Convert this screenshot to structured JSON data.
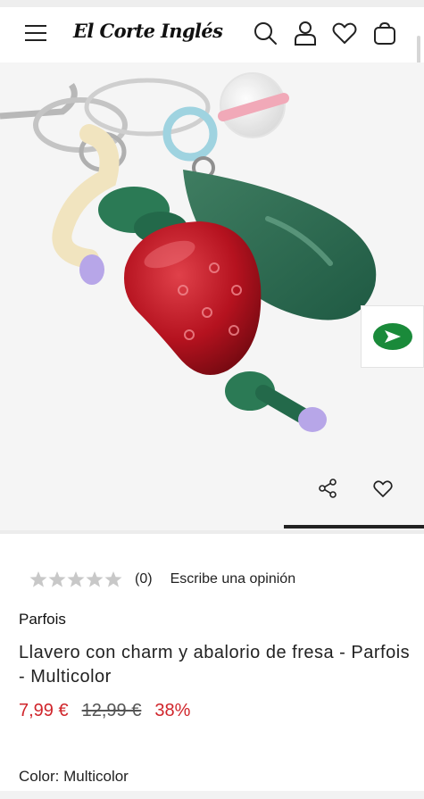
{
  "header": {
    "logo_text": "El Corte Inglés",
    "menu_icon": "hamburger-menu-icon",
    "search_icon": "search-icon",
    "account_icon": "user-icon",
    "wishlist_icon": "heart-icon",
    "cart_icon": "shopping-bag-icon"
  },
  "gallery": {
    "share_icon": "share-icon",
    "favorite_icon": "heart-icon",
    "badge_icon": "green-arrow-icon"
  },
  "product": {
    "rating": {
      "stars": 0,
      "max_stars": 5,
      "count": "(0)",
      "review_link": "Escribe una opinión"
    },
    "brand": "Parfois",
    "title": "Llavero con charm y abalorio de fresa - Parfois - Multicolor",
    "price_current": "7,99 €",
    "price_original": "12,99 €",
    "discount": "38%",
    "color_prefix": "Color:",
    "color_value": "Multicolor"
  },
  "colors": {
    "price_red": "#d0252b",
    "brand_green": "#1a8a3a",
    "star_gray": "#c8c8c8"
  }
}
